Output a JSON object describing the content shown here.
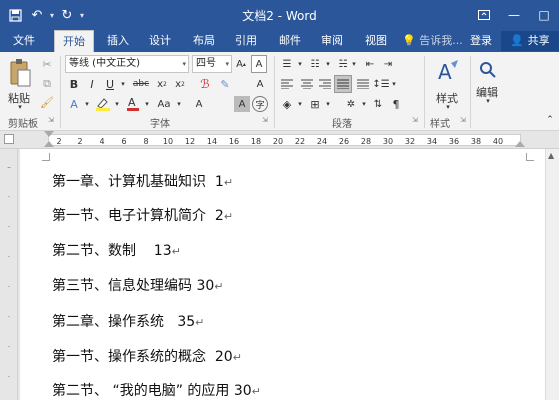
{
  "app": {
    "title": "文档2 - Word"
  },
  "quick_access": {
    "icons": [
      "save-icon",
      "undo-icon",
      "redo-icon",
      "customize-qat-icon"
    ]
  },
  "tabs": [
    {
      "label": "文件"
    },
    {
      "label": "开始"
    },
    {
      "label": "插入"
    },
    {
      "label": "设计"
    },
    {
      "label": "布局"
    },
    {
      "label": "引用"
    },
    {
      "label": "邮件"
    },
    {
      "label": "审阅"
    },
    {
      "label": "视图"
    }
  ],
  "tell_me": "告诉我...",
  "login": "登录",
  "share": "共享",
  "ribbon": {
    "clipboard": {
      "paste_label": "粘贴",
      "group_label": "剪贴板"
    },
    "font": {
      "font_name": "等线 (中文正文)",
      "font_size": "四号",
      "group_label": "字体"
    },
    "paragraph": {
      "group_label": "段落"
    },
    "styles": {
      "styles_label": "样式",
      "group_label": "样式"
    },
    "editing": {
      "editing_label": "编辑"
    }
  },
  "ruler": {
    "ticks": [
      "2",
      "2",
      "4",
      "6",
      "8",
      "10",
      "12",
      "14",
      "16",
      "18",
      "20",
      "22",
      "24",
      "26",
      "28",
      "30",
      "32",
      "34",
      "36",
      "38",
      "40"
    ]
  },
  "document": {
    "lines": [
      {
        "text": "第一章、计算机基础知识  1"
      },
      {
        "text": "第一节、电子计算机简介  2"
      },
      {
        "text": "第二节、数制    13"
      },
      {
        "text": "第三节、信息处理编码 30"
      },
      {
        "text": "第二章、操作系统   35"
      },
      {
        "text": "第一节、操作系统的概念  20"
      },
      {
        "text": "第二节、 “我的电脑” 的应用 30"
      }
    ],
    "paragraph_mark": "↵"
  },
  "colors": {
    "brand": "#2b579a",
    "ribbon_bg": "#f3f3f3",
    "font_color_red": "#d32f2f",
    "highlight_yellow": "#ffeb3b"
  }
}
